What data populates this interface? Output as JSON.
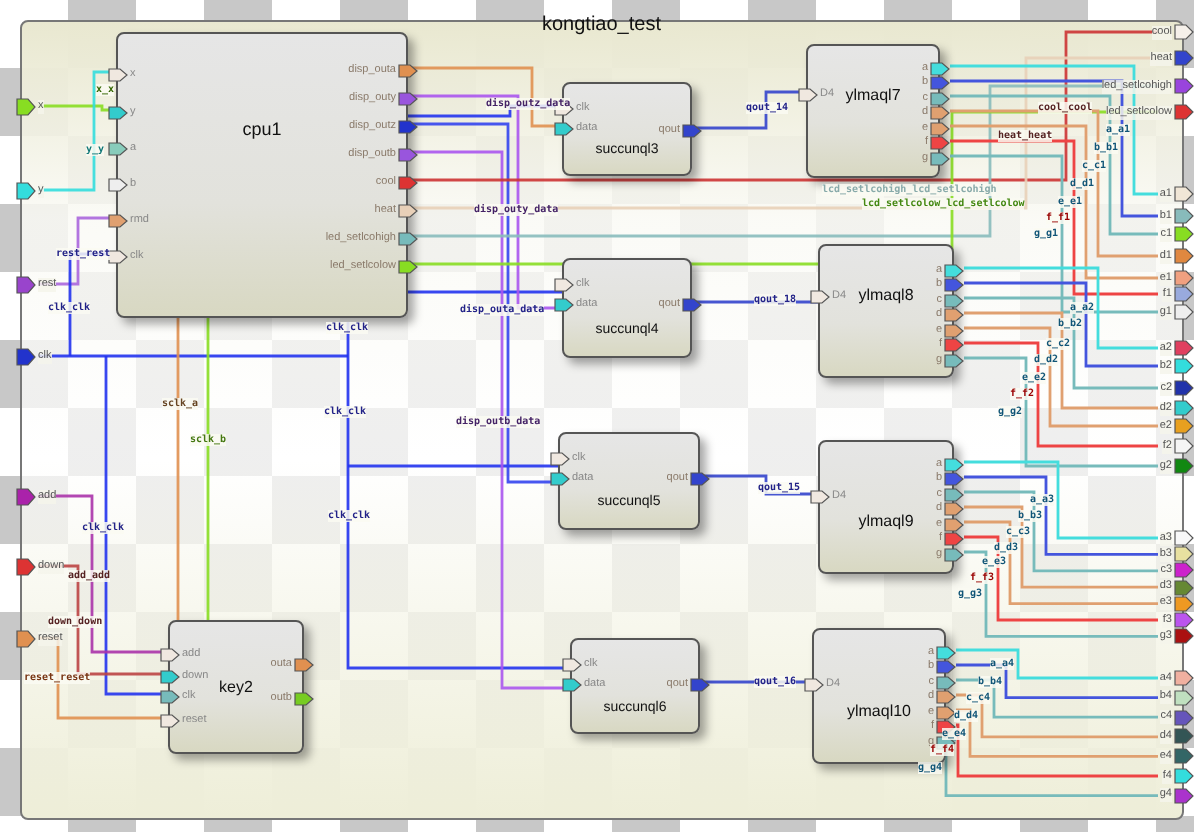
{
  "title": "kongtiao_test",
  "inputs": [
    {
      "label": "x",
      "color": "#88dd22"
    },
    {
      "label": "y",
      "color": "#33dddd"
    },
    {
      "label": "rest",
      "color": "#9944cc"
    },
    {
      "label": "clk",
      "color": "#2233cc"
    },
    {
      "label": "add",
      "color": "#aa22aa"
    },
    {
      "label": "down",
      "color": "#dd3333"
    },
    {
      "label": "reset",
      "color": "#e09050"
    }
  ],
  "modules": [
    {
      "name": "cpu1",
      "inputs": [
        {
          "label": "x",
          "color": "#f0e8e0"
        },
        {
          "label": "y",
          "color": "#33cccc"
        },
        {
          "label": "a",
          "color": "#88ccbb"
        },
        {
          "label": "b",
          "color": "#eeeeee"
        },
        {
          "label": "rmd",
          "color": "#e0a070"
        },
        {
          "label": "clk",
          "color": "#f0e8e0"
        }
      ],
      "outputs": [
        {
          "label": "disp_outa",
          "color": "#e09050"
        },
        {
          "label": "disp_outy",
          "color": "#9955dd"
        },
        {
          "label": "disp_outz",
          "color": "#2233cc"
        },
        {
          "label": "disp_outb",
          "color": "#9955dd"
        },
        {
          "label": "cool",
          "color": "#dd3333"
        },
        {
          "label": "heat",
          "color": "#e8d0b8"
        },
        {
          "label": "led_setlcohigh",
          "color": "#77bbbb"
        },
        {
          "label": "led_setlcolow",
          "color": "#88dd22"
        }
      ]
    },
    {
      "name": "succunql3",
      "inputs": [
        {
          "label": "clk",
          "color": "#f0e8e0"
        },
        {
          "label": "data",
          "color": "#33cccc"
        }
      ],
      "outputs": [
        {
          "label": "qout",
          "color": "#3344cc"
        }
      ]
    },
    {
      "name": "ylmaql7",
      "inputs": [
        {
          "label": "D4",
          "color": "#f0e8e0"
        }
      ],
      "outputs": [
        {
          "label": "a",
          "color": "#44dddd"
        },
        {
          "label": "b",
          "color": "#4455dd"
        },
        {
          "label": "c",
          "color": "#77bbbb"
        },
        {
          "label": "d",
          "color": "#e0a070"
        },
        {
          "label": "e",
          "color": "#e0a070"
        },
        {
          "label": "f",
          "color": "#ee4444"
        },
        {
          "label": "g",
          "color": "#77bbbb"
        }
      ],
      "net_labels": [
        "a_a1",
        "b_b1",
        "c_c1",
        "d_d1",
        "e_e1",
        "f_f1",
        "g_g1"
      ]
    },
    {
      "name": "succunql4",
      "inputs": [
        {
          "label": "clk",
          "color": "#f0e8e0"
        },
        {
          "label": "data",
          "color": "#33cccc"
        }
      ],
      "outputs": [
        {
          "label": "qout",
          "color": "#3344cc"
        }
      ]
    },
    {
      "name": "ylmaql8",
      "inputs": [
        {
          "label": "D4",
          "color": "#f0e8e0"
        }
      ],
      "outputs": [
        {
          "label": "a",
          "color": "#44dddd"
        },
        {
          "label": "b",
          "color": "#4455dd"
        },
        {
          "label": "c",
          "color": "#77bbbb"
        },
        {
          "label": "d",
          "color": "#e0a070"
        },
        {
          "label": "e",
          "color": "#e0a070"
        },
        {
          "label": "f",
          "color": "#ee4444"
        },
        {
          "label": "g",
          "color": "#77bbbb"
        }
      ],
      "net_labels": [
        "a_a2",
        "b_b2",
        "c_c2",
        "d_d2",
        "e_e2",
        "f_f2",
        "g_g2"
      ]
    },
    {
      "name": "succunql5",
      "inputs": [
        {
          "label": "clk",
          "color": "#f0e8e0"
        },
        {
          "label": "data",
          "color": "#33cccc"
        }
      ],
      "outputs": [
        {
          "label": "qout",
          "color": "#3344cc"
        }
      ]
    },
    {
      "name": "ylmaql9",
      "inputs": [
        {
          "label": "D4",
          "color": "#f0e8e0"
        }
      ],
      "outputs": [
        {
          "label": "a",
          "color": "#44dddd"
        },
        {
          "label": "b",
          "color": "#4455dd"
        },
        {
          "label": "c",
          "color": "#77bbbb"
        },
        {
          "label": "d",
          "color": "#e0a070"
        },
        {
          "label": "e",
          "color": "#e0a070"
        },
        {
          "label": "f",
          "color": "#ee4444"
        },
        {
          "label": "g",
          "color": "#77bbbb"
        }
      ],
      "net_labels": [
        "a_a3",
        "b_b3",
        "c_c3",
        "d_d3",
        "e_e3",
        "f_f3",
        "g_g3"
      ]
    },
    {
      "name": "key2",
      "inputs": [
        {
          "label": "add",
          "color": "#f0e8e0"
        },
        {
          "label": "down",
          "color": "#33cccc"
        },
        {
          "label": "clk",
          "color": "#77bbbb"
        },
        {
          "label": "reset",
          "color": "#f0e8e0"
        }
      ],
      "outputs": [
        {
          "label": "outa",
          "color": "#e09050"
        },
        {
          "label": "outb",
          "color": "#77cc22"
        }
      ]
    },
    {
      "name": "succunql6",
      "inputs": [
        {
          "label": "clk",
          "color": "#f0e8e0"
        },
        {
          "label": "data",
          "color": "#33cccc"
        }
      ],
      "outputs": [
        {
          "label": "qout",
          "color": "#3344cc"
        }
      ]
    },
    {
      "name": "ylmaql10",
      "inputs": [
        {
          "label": "D4",
          "color": "#f0e8e0"
        }
      ],
      "outputs": [
        {
          "label": "a",
          "color": "#44dddd"
        },
        {
          "label": "b",
          "color": "#4455dd"
        },
        {
          "label": "c",
          "color": "#77bbbb"
        },
        {
          "label": "d",
          "color": "#e0a070"
        },
        {
          "label": "e",
          "color": "#e0a070"
        },
        {
          "label": "f",
          "color": "#ee4444"
        },
        {
          "label": "g",
          "color": "#77bbbb"
        }
      ],
      "net_labels": [
        "a_a4",
        "b_b4",
        "c_c4",
        "d_d4",
        "e_e4",
        "f_f4",
        "g_g4"
      ]
    }
  ],
  "outputs": [
    {
      "label": "cool",
      "color": "#f5f0ea"
    },
    {
      "label": "heat",
      "color": "#3344cc"
    },
    {
      "label": "led_setlcohigh",
      "color": "#9944dd"
    },
    {
      "label": "led_setlcolow",
      "color": "#dd3333"
    },
    {
      "label": "a1",
      "color": "#f0e6d6"
    },
    {
      "label": "b1",
      "color": "#88bbbb"
    },
    {
      "label": "c1",
      "color": "#88dd22"
    },
    {
      "label": "d1",
      "color": "#e08840"
    },
    {
      "label": "e1",
      "color": "#f0a080"
    },
    {
      "label": "f1",
      "color": "#99aadd"
    },
    {
      "label": "g1",
      "color": "#eeeeee"
    },
    {
      "label": "a2",
      "color": "#e04060"
    },
    {
      "label": "b2",
      "color": "#33dddd"
    },
    {
      "label": "c2",
      "color": "#2233aa"
    },
    {
      "label": "d2",
      "color": "#33cccc"
    },
    {
      "label": "e2",
      "color": "#e8a020"
    },
    {
      "label": "f2",
      "color": "#f5f5f5"
    },
    {
      "label": "g2",
      "color": "#118811"
    },
    {
      "label": "a3",
      "color": "#f8f8f8"
    },
    {
      "label": "b3",
      "color": "#e8e0a0"
    },
    {
      "label": "c3",
      "color": "#cc22cc"
    },
    {
      "label": "d3",
      "color": "#668833"
    },
    {
      "label": "e3",
      "color": "#ee9922"
    },
    {
      "label": "f3",
      "color": "#bb55ee"
    },
    {
      "label": "g3",
      "color": "#aa1111"
    },
    {
      "label": "a4",
      "color": "#f0b0a0"
    },
    {
      "label": "b4",
      "color": "#c0e0c0"
    },
    {
      "label": "c4",
      "color": "#6655bb"
    },
    {
      "label": "d4",
      "color": "#335555"
    },
    {
      "label": "e4",
      "color": "#336666"
    },
    {
      "label": "f4",
      "color": "#33dddd"
    },
    {
      "label": "g4",
      "color": "#aa33cc"
    }
  ],
  "net_labels": [
    "x_x",
    "y_y",
    "rest_rest",
    "clk_clk",
    "clk_clk",
    "disp_outz_data",
    "disp_outy_data",
    "disp_outa_data",
    "disp_outb_data",
    "clk_clk",
    "clk_clk",
    "clk_clk",
    "add_add",
    "down_down",
    "reset_reset",
    "sclk_a",
    "sclk_b",
    "qout_14",
    "qout_18",
    "qout_15",
    "qout_16",
    "cool_cool",
    "heat_heat",
    "lcd_setlcohigh_lcd_setlcohigh",
    "lcd_setlcolow_lcd_setlcolow"
  ]
}
